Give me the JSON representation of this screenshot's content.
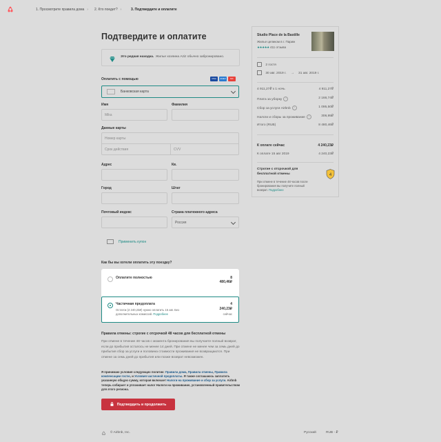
{
  "logo_icon": "airbnb-logo",
  "breadcrumb": {
    "steps": [
      "1. Просмотрите правила дома",
      "2. Кто поедет?",
      "3. Подтвердите и оплатите"
    ]
  },
  "page_title": "Подтвердите и оплатите",
  "rare_find": {
    "title": "Это редкая находка.",
    "text": "Жилье хозяина Aziz обычно забронировано."
  },
  "payment": {
    "label": "Оплатить с помощью",
    "method": "Банковская карта",
    "card_logos": [
      "VISA",
      "AMEX",
      "MC"
    ]
  },
  "form": {
    "first_name_label": "Имя",
    "first_name_value": "Mika",
    "last_name_label": "Фамилия",
    "last_name_value": "",
    "card_label": "Данные карты",
    "card_number_placeholder": "Номер карты",
    "expiry_placeholder": "Срок действия",
    "cvv_placeholder": "CVV",
    "address_label": "Адрес",
    "apt_label": "Кв.",
    "city_label": "Город",
    "state_label": "Штат",
    "zip_label": "Почтовый индекс",
    "country_label": "Страна платежного адреса",
    "country_value": "Россия"
  },
  "coupon": "Применить купон",
  "pay_question": "Как бы вы хотели оплатить эту поездку?",
  "options": {
    "full": {
      "title": "Оплатите полностью",
      "amount_line1": "8",
      "amount_line2": "480,46₽"
    },
    "partial": {
      "title": "Частичная предоплата",
      "desc1": "Остаток (4 240,23₽) нужно оплатить 15 авг. Без",
      "desc2": "дополнительных комиссий.",
      "more": "Подробнее",
      "amount_line1": "4",
      "amount_line2": "240,23₽",
      "amount_line3": "сейчас"
    }
  },
  "cancel": {
    "heading": "Правила отмены: строгие с отсрочкой 48 часов для бесплатной отмены",
    "text": "При отмене в течение 48 часов с момента бронирования вы получаете полный возврат, если до прибытия осталось не менее 14 дней. При отмене не менее чем за семь дней до прибытия сбор за услуги и половина стоимости проживания не возвращаются. При отмене за семь дней до прибытия или позже возврат невозможен."
  },
  "terms": {
    "p1": "Я принимаю условия следующих политик: ",
    "l1": "Правила дома",
    "s1": ", ",
    "l2": "Правила отмены",
    "s2": ", ",
    "l3": "Правила компенсации гостю",
    "s3": ", и ",
    "l4": "Условия частичной предоплаты",
    "p2": ". Я также соглашаюсь заплатить указанную общую сумму, которая включает ",
    "l5": "Налоги на проживание и сбор за услуги",
    "p3": ". Airbnb теперь собирает и уплачивает налог Налоги на проживание, установленный правительством для этого региона."
  },
  "confirm_button": "Подтвердить и продолжить",
  "footer": {
    "copyright": "© Airbnb, Inc.",
    "language": "Русский",
    "currency": "RUB - ₽"
  },
  "listing": {
    "title": "Studio Place de la Bastille",
    "subtitle": "Жилье целиком в г. Париж",
    "rating_stars": 5,
    "reviews": "411 отзыва",
    "guests": "2 гостя",
    "check_in": "30 авг. 2019 г.",
    "check_out": "31 авг. 2019 г.",
    "arrow": "→"
  },
  "prices": [
    {
      "label": "4 911,27₽ x 1 ночь",
      "value": "4 911,27₽",
      "help": false
    },
    {
      "label": "Плата за уборку",
      "value": "2 166,74₽",
      "help": true
    },
    {
      "label": "Сбор за услуги Airbnb",
      "value": "1 095,50₽",
      "help": true
    },
    {
      "label": "Налоги и сборы за проживание",
      "value": "306,95₽",
      "help": true
    },
    {
      "label": "Итого (RUB)",
      "value": "8 480,46₽",
      "help": false
    }
  ],
  "due_now": {
    "label": "К оплате сейчас",
    "value": "4 240,23₽"
  },
  "due_later": {
    "label": "К оплате 15 авг 2019",
    "value": "4 240,23₽"
  },
  "policy_box": {
    "title": "Строгие с отсрочкой для бесплатной отмены",
    "text": "При отмене в течение 48 часов после бронирования вы получите полный возврат.",
    "link": "Подробнее"
  },
  "colors": {
    "accent": "#1d8a84",
    "brand": "#ff5a5f",
    "button": "#c8333f"
  }
}
